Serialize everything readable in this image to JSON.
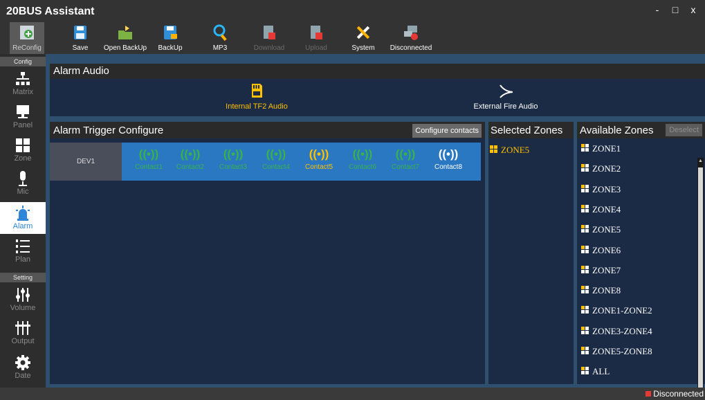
{
  "app": {
    "title": "20BUS Assistant",
    "window_controls": {
      "minimize": "-",
      "maximize": "□",
      "close": "x"
    }
  },
  "toolbar": {
    "items": [
      {
        "label": "ReConfig",
        "icon": "reconfig-icon",
        "state": "active"
      },
      {
        "label": "Save",
        "icon": "save-icon",
        "state": "enabled"
      },
      {
        "label": "Open BackUp",
        "icon": "open-folder-icon",
        "state": "enabled"
      },
      {
        "label": "BackUp",
        "icon": "backup-icon",
        "state": "enabled"
      },
      {
        "label": "MP3",
        "icon": "magnifier-icon",
        "state": "enabled"
      },
      {
        "label": "Download",
        "icon": "download-icon",
        "state": "disabled"
      },
      {
        "label": "Upload",
        "icon": "upload-icon",
        "state": "disabled"
      },
      {
        "label": "System",
        "icon": "tools-icon",
        "state": "enabled"
      },
      {
        "label": "Disconnected",
        "icon": "network-disconnected-icon",
        "state": "enabled"
      }
    ]
  },
  "nav": {
    "sections": {
      "config": "Config",
      "setting": "Setting"
    },
    "items": [
      {
        "label": "Matrix",
        "icon": "hierarchy-icon"
      },
      {
        "label": "Panel",
        "icon": "monitor-icon"
      },
      {
        "label": "Zone",
        "icon": "grid-icon"
      },
      {
        "label": "Mic",
        "icon": "microphone-icon"
      },
      {
        "label": "Alarm",
        "icon": "alarm-light-icon",
        "active": true
      },
      {
        "label": "Plan",
        "icon": "numbered-list-icon"
      },
      {
        "label": "Volume",
        "icon": "volume-sliders-icon"
      },
      {
        "label": "Output",
        "icon": "output-sliders-icon"
      },
      {
        "label": "Date",
        "icon": "gear-icon"
      }
    ]
  },
  "alarm_audio": {
    "title": "Alarm Audio",
    "options": [
      {
        "label": "Internal TF2 Audio",
        "icon": "sd-card-icon",
        "selected": true
      },
      {
        "label": "External Fire Audio",
        "icon": "external-audio-icon",
        "selected": false
      }
    ]
  },
  "trigger": {
    "title": "Alarm Trigger Configure",
    "configure_button": "Configure contacts",
    "device": "DEV1",
    "contacts": [
      {
        "label": "Contact1",
        "state": "green"
      },
      {
        "label": "Contact2",
        "state": "green"
      },
      {
        "label": "Contact3",
        "state": "green"
      },
      {
        "label": "Contact4",
        "state": "green"
      },
      {
        "label": "Contact5",
        "state": "yellow"
      },
      {
        "label": "Contact6",
        "state": "green"
      },
      {
        "label": "Contact7",
        "state": "green"
      },
      {
        "label": "Contact8",
        "state": "white"
      }
    ]
  },
  "selected_zones": {
    "title": "Selected Zones",
    "items": [
      "ZONE5"
    ]
  },
  "available_zones": {
    "title": "Available Zones",
    "deselect_button": "Deselect",
    "items": [
      "ZONE1",
      "ZONE2",
      "ZONE3",
      "ZONE4",
      "ZONE5",
      "ZONE6",
      "ZONE7",
      "ZONE8",
      "ZONE1-ZONE2",
      "ZONE3-ZONE4",
      "ZONE5-ZONE8",
      "ALL"
    ]
  },
  "status": {
    "text": "Disconnected"
  },
  "colors": {
    "accent_blue": "#2b78c2",
    "active_yellow": "#ffc000",
    "contact_green": "#37b34a",
    "panel_bg": "#1c2b45"
  }
}
